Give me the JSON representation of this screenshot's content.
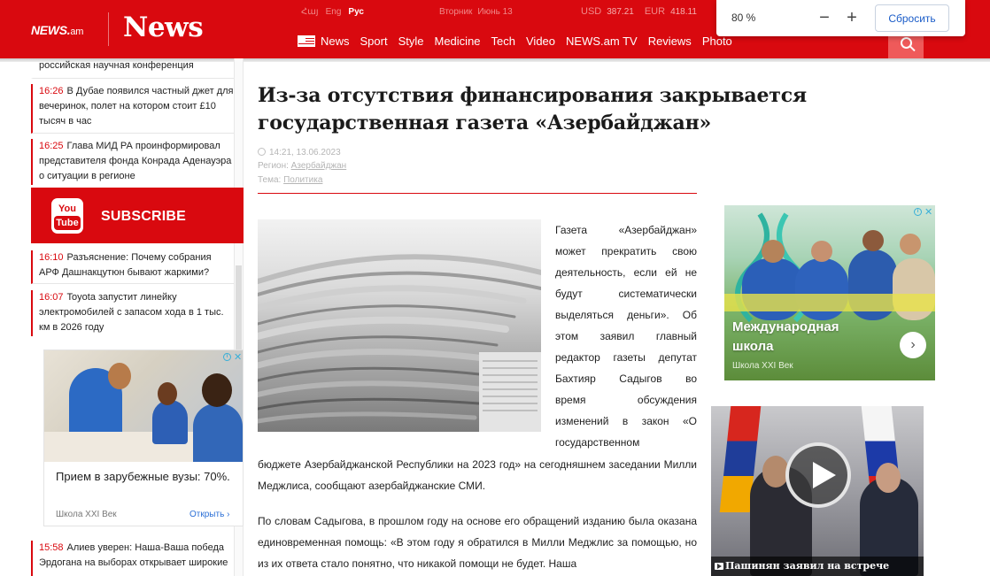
{
  "header": {
    "logo_small": "NEWS.",
    "logo_small_suffix": "am",
    "logo_big": "News",
    "languages": [
      "Հայ",
      "Eng",
      "Рус"
    ],
    "active_language": "Рус",
    "weekday": "Вторник",
    "date": "Июнь 13",
    "rates": [
      {
        "code": "USD",
        "value": "387.21"
      },
      {
        "code": "EUR",
        "value": "418.11"
      }
    ],
    "nav": [
      "News",
      "Sport",
      "Style",
      "Medicine",
      "Tech",
      "Video",
      "NEWS.am TV",
      "Reviews",
      "Photo"
    ]
  },
  "zoom_popup": {
    "level": "80 %",
    "minus": "−",
    "plus": "+",
    "reset_label": "Сбросить"
  },
  "left_news": [
    {
      "time": "",
      "text": "российская научная конференция"
    },
    {
      "time": "16:26",
      "text": "В Дубае появился частный джет для вечеринок, полет на котором стоит £10 тысяч в час"
    },
    {
      "time": "16:25",
      "text": "Глава МИД РА проинформировал представителя фонда Конрада Аденауэра о ситуации в регионе"
    },
    {
      "time": "16:10",
      "text": "Разъяснение: Почему собрания АРФ Дашнакцутюн бывают жаркими?"
    },
    {
      "time": "16:07",
      "text": "Toyota запустит линейку электромобилей с запасом хода в 1 тыс. км в 2026 году"
    },
    {
      "time": "15:58",
      "text": "Алиев уверен: Наша-Ваша победа Эрдогана на выборах открывает широкие"
    }
  ],
  "youtube_banner": {
    "logo_top": "You",
    "logo_bottom": "Tube",
    "label": "SUBSCRIBE"
  },
  "ad_left": {
    "title": "Прием в зарубежные вузы: 70%.",
    "source": "Школа XXI Век",
    "open_label": "Открыть",
    "open_arrow": "›"
  },
  "article": {
    "title": "Из-за отсутствия финансирования закрывается государственная газета «Азербайджан»",
    "datetime": "14:21, 13.06.2023",
    "region_label": "Регион:",
    "region_value": "Азербайджан",
    "topic_label": "Тема:",
    "topic_value": "Политика",
    "p1_lines": [
      "Газета «Азербайджан»",
      "может прекратить свою",
      "деятельность, если ей не",
      "будут систематически",
      "выделяться деньги». Об",
      "этом заявил главный",
      "редактор газеты депутат",
      "Бахтияр Садыгов во",
      "время обсуждения",
      "изменений в закон «О",
      "государственном"
    ],
    "p1_tail": "бюджете Азербайджанской Республики на 2023 год» на сегодняшнем заседании Милли Меджлиса, сообщают азербайджанские СМИ.",
    "p2": "По словам Садыгова, в прошлом году на основе его обращений изданию была оказана единовременная помощь: «В этом году я обратился в Милли Меджлис за помощью, но из их ответа стало понятно, что никакой помощи не будет. Наша"
  },
  "ad_right": {
    "title": "Международная школа",
    "source": "Школа XXI Век",
    "next": "›"
  },
  "video": {
    "caption": "Пашинян заявил на встрече"
  },
  "colors": {
    "brand_red": "#d9090f",
    "link_blue": "#2b6fd6"
  }
}
